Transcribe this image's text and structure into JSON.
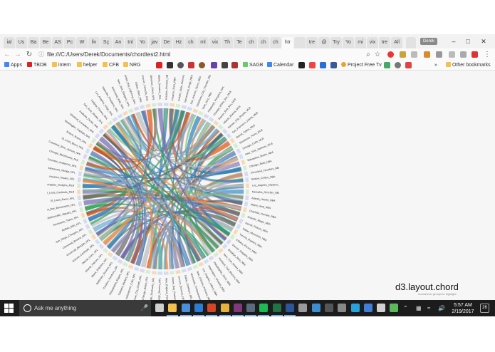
{
  "browser": {
    "tabs": [
      "ial",
      "Us",
      "Ba",
      "Be",
      "AS",
      "Pc",
      "W",
      "liv",
      "Sç",
      "An",
      "tnl",
      "Yo",
      "jav",
      "De",
      "Hz",
      "ch",
      "ml",
      "vix",
      "Th",
      "Te",
      "ch",
      "ch",
      "ch",
      "htr",
      "",
      "tre",
      "@",
      "Try",
      "Yo",
      "mi",
      "vix",
      "tre",
      "All"
    ],
    "active_tab_index": 23,
    "profile_label": "Derek",
    "address": "file:///C:/Users/Derek/Documents/chordtest2.html",
    "bookmarks": [
      {
        "label": "Apps",
        "kind": "apps"
      },
      {
        "label": "TBDB",
        "kind": "site"
      },
      {
        "label": "intern",
        "kind": "folder"
      },
      {
        "label": "helper",
        "kind": "folder"
      },
      {
        "label": "CFB",
        "kind": "folder"
      },
      {
        "label": "NRG",
        "kind": "folder"
      },
      {
        "label": "SAGB",
        "kind": "site"
      },
      {
        "label": "Calendar",
        "kind": "site"
      },
      {
        "label": "Project Free Tv",
        "kind": "site"
      },
      {
        "label": "»",
        "kind": "more"
      },
      {
        "label": "Other bookmarks",
        "kind": "folder"
      }
    ]
  },
  "page": {
    "title": "d3.layout.chord",
    "subtitle": "mouseover groups to highlight",
    "team_labels": [
      "Houston_Rockets_NBA",
      "Phoenix_Suns_NBA",
      "Golden_State_Warriors_NBA",
      "Sacramento_Kings_NBA",
      "San_Antonio_Spurs_NBA",
      "Oklahoma_City_Thunder_NBA",
      "Utah_Jazz_NBA",
      "Pittsburgh_Penguins_NHL",
      "Chicago_White_Sox_MLB",
      "Boston_Red_Sox_MLB",
      "Atlanta_Braves_MLB",
      "Kansas_City_Royals_MLB",
      "San_Francisco_Giants_MLB",
      "Detroit_Tigers_MLB",
      "Minnesota_Twins_MLB",
      "Chicago_Cubs_MLB",
      "New_York_Yankees_MLB",
      "Milwaukee_Bucks_NBA",
      "Chicago_Bulls_NBA",
      "Cleveland_Cavaliers_NBA",
      "Boston_Celtics_NBA",
      "Los_Angeles_Clippers_NBA",
      "Memphis_Grizzlies_NBA",
      "Atlanta_Hawks_NBA",
      "Miami_Heat_NBA",
      "Charlotte_Hornets_NBA",
      "Orlando_Magic_NBA",
      "Detroit_Pistons_NBA",
      "Dallas_Mavericks_NBA",
      "Toronto_Raptors_NBA",
      "Indiana_Pacers_NBA",
      "Denver_Nuggets_NBA",
      "Brooklyn_Nets_NBA",
      "New_York_Knicks_NBA",
      "Portland_Trail_Blazers_NBA",
      "Philadelphia_76ers_NBA",
      "Washington_Wizards_NBA",
      "Los_Angeles_Lakers_NBA",
      "New_Orleans_Pelicans_NBA",
      "Minnesota_Timberwolves_NBA",
      "Dallas_Cowboys_NFL",
      "Denver_Broncos_NFL",
      "Green_Bay_Packers_NFL",
      "New_England_Patriots_NFL",
      "Pittsburgh_Steelers_NFL",
      "Seattle_Seahawks_NFL",
      "Chicago_Bears_NFL",
      "Kansas_City_Chiefs_NFL",
      "Indianapolis_Colts_NFL",
      "Oakland_Raiders_NFL",
      "Philadelphia_Eagles_NFL",
      "Carolina_Panthers_NFL",
      "Baltimore_Ravens_NFL",
      "Miami_Dolphins_NFL",
      "Atlanta_Falcons_NFL",
      "Detroit_Lions_NFL",
      "Arizona_Cardinals_NFL",
      "Cincinnati_Bengals_NFL",
      "Cleveland_Browns_NFL",
      "San_Diego_Chargers_NFL",
      "Buffalo_Bills_NFL",
      "Tennessee_Titans_NFL",
      "Jacksonville_Jaguars_NFL",
      "Tampa_Bay_Buccaneers_NFL",
      "St_Louis_Rams_NFL",
      "Saint_Louis_Cardinals_MLB",
      "Los_Angeles_Dodgers_MLB",
      "Houston_Texans_NFL",
      "Minnesota_Vikings_NFL",
      "Colorado_Avalanche_NHL",
      "Chicago_Blackhawks_NHL",
      "Columbus_Blue_Jackets_NHL",
      "St_Louis_Blues_NHL",
      "Boston_Bruins_NHL",
      "Washington_Capitals_NHL",
      "Montreal_Canadiens_NHL",
      "Anaheim_Ducks_NHL",
      "San_Jose_Sharks_NHL",
      "Calgary_Flames_NHL",
      "Los_Angeles_Kings_NHL",
      "Nashville_Predators_NHL",
      "Minnesota_Wild_NHL",
      "New_York_Rangers_NHL",
      "Tampa_Bay_Lightning_NHL",
      "Dallas_Stars_NHL",
      "Vancouver_Canucks_NHL",
      "Edmonton_Oilers_NHL",
      "Ottawa_Senators_NHL"
    ],
    "ribbon_colors": [
      "#2c7fb8",
      "#e6550d",
      "#31a354",
      "#756bb1",
      "#636363",
      "#9e9ac8",
      "#3182bd",
      "#fd8d3c",
      "#74c476",
      "#969696",
      "#6baed6",
      "#bdbdbd"
    ]
  },
  "taskbar": {
    "search_placeholder": "Ask me anything",
    "time": "5:57 AM",
    "date": "2/19/2017",
    "notification_count": "26",
    "apps": [
      {
        "name": "task-view-icon",
        "color": "#cfcfcf"
      },
      {
        "name": "file-explorer-icon",
        "color": "#f3c14e"
      },
      {
        "name": "store-icon",
        "color": "#4a90d9"
      },
      {
        "name": "edge-icon",
        "color": "#2b7cd3"
      },
      {
        "name": "powerpoint-icon",
        "color": "#d24726"
      },
      {
        "name": "chrome-icon",
        "color": "#e8b23a"
      },
      {
        "name": "onenote-icon",
        "color": "#80397b"
      },
      {
        "name": "steam-icon",
        "color": "#5a6b7d"
      },
      {
        "name": "spotify-icon",
        "color": "#1db954"
      },
      {
        "name": "excel-icon",
        "color": "#217346"
      },
      {
        "name": "word-icon",
        "color": "#2b579a"
      },
      {
        "name": "print-icon",
        "color": "#9a9a9a"
      },
      {
        "name": "network-app-icon",
        "color": "#3b8fd1"
      },
      {
        "name": "terminal-icon",
        "color": "#555555"
      },
      {
        "name": "window-app-icon",
        "color": "#888888"
      },
      {
        "name": "vpn-icon",
        "color": "#27a2db"
      },
      {
        "name": "media-icon",
        "color": "#3f7fd8"
      },
      {
        "name": "globe-app-icon",
        "color": "#d0d0d0"
      },
      {
        "name": "check-app-icon",
        "color": "#5cb85c"
      }
    ]
  }
}
